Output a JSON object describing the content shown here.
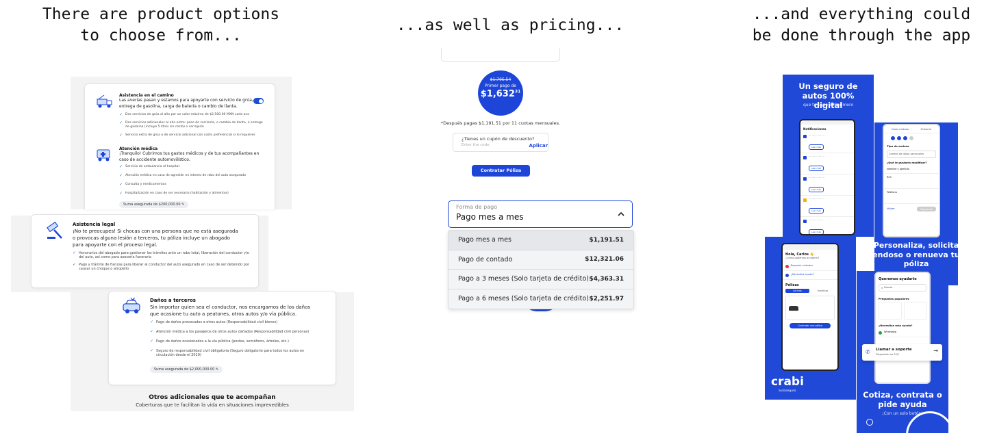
{
  "captions": {
    "left_line1": "There are product options",
    "left_line2": "to choose from...",
    "center": "...as well as pricing...",
    "right_line1": "...and everything could",
    "right_line2": "be done through the app"
  },
  "panel1": {
    "asistencia_camino": {
      "title": "Asistencia en el camino",
      "desc": "Las averías pasan y estamos para apoyarte con servicio de grúa, entrega de gasolina, carga de batería o cambio de llanta.",
      "bullets": [
        "Dos servicios de grúa al año por un valor máximo de $2,500.00 MXN cada uno",
        "Dos servicios adicionales al año entre: paso de corriente, o cambio de llanta, o entrega de gasolina (incluye 5 litros sin costo) o cerrajería",
        "Servicio extra de grúa o de servicio adicional con costo preferencial si lo requieres"
      ]
    },
    "atencion_medica": {
      "title": "Atención médica",
      "desc": "¡Tranquilo! Cubrimos tus gastos médicos y de tus acompañantes en caso de accidente automovilístico.",
      "bullets": [
        "Servicio de ambulancia al hospital",
        "Atención médica en caso de agresión en intento de robo del auto asegurado",
        "Consulta y medicamentos",
        "Hospitalización en caso de ser necesario (habitación y alimentos)"
      ],
      "sum_label": "Suma asegurada de $200,000.00"
    },
    "asistencia_legal": {
      "title": "Asistencia legal",
      "desc": "¡No te preocupes! Si chocas con una persona que no está asegurada o provocas alguna lesión a terceros, tu póliza incluye un abogado para apoyarte con el proceso legal.",
      "bullets": [
        "Honorarios del abogado para gestionar los trámites ante un robo total, liberación del conductor y/o del auto, así como para asesoría funeraria",
        "Pago y trámite de fianzas para liberar al conductor del auto asegurado en caso de ser detenido por causar un choque o atropello"
      ]
    },
    "danos_terceros": {
      "title": "Daños a terceros",
      "desc": "Sin importar quien sea el conductor, nos encargamos de los daños que ocasione tu auto a peatones, otros autos y/o vía pública.",
      "bullets": [
        "Pago de daños provocados a otros autos (Responsabilidad civil bienes)",
        "Atención médica a los pasajeros de otros autos dañados (Responsabilidad civil personas)",
        "Pago de daños ocasionados a la vía pública (postes, semáforos, árboles, etc.)",
        "Seguro de responsabilidad civil obligatoria (Seguro obligatorio para todos los autos en circulación desde el 2019)"
      ],
      "sum_label": "Suma asegurada de $2,000,000.00"
    },
    "otros": {
      "title": "Otros adicionales que te acompañan",
      "subtitle": "Coberturas que te facilitan la vida en situaciones imprevedibles"
    }
  },
  "panel2": {
    "old_price": "$1,795.54",
    "first_payment_label": "Primer pago de",
    "price_main": "$1,632",
    "price_cents": "31",
    "after_payments": "*Después pagas $1,191.51 por 11 cuotas mensuales.",
    "coupon_label": "¿Tienes un cupón de descuento?",
    "coupon_placeholder": "Enter the code",
    "apply_label": "Aplicar",
    "contract_label": "Contratar Póliza",
    "payment_form_label": "Forma de pago",
    "payment_selected": "Pago mes a mes",
    "payment_options": [
      {
        "label": "Pago mes a mes",
        "amount": "$1,191.51"
      },
      {
        "label": "Pago de contado",
        "amount": "$12,321.06"
      },
      {
        "label": "Pago a 3 meses (Solo tarjeta de crédito)",
        "amount": "$4,363.31"
      },
      {
        "label": "Pago a 6 meses (Solo tarjeta de crédito)",
        "amount": "$2,251.97"
      }
    ]
  },
  "panel3": {
    "headline1": "Un seguro de autos 100% digital",
    "sub1": "que te pone a ti primero",
    "headline2": "Personaliza, solicita endoso o renueva tu póliza",
    "headline3": "Cotiza, contrata o pide ayuda",
    "sub3": "¡Con un solo botón!",
    "brand": "crabi",
    "brand_sub": "autoseguro",
    "phone1": {
      "title": "Notificaciones",
      "btn": "Leer más"
    },
    "phone2": {
      "tab1": "Crear endoso",
      "tab2": "Historial",
      "field1": "Tipo de endoso",
      "field1_value": "Cambio de datos personales",
      "field2": "¿Qué le gustaría modificar?",
      "row1": "Nombre y apellido",
      "row2": "RFC",
      "row3": "Teléfono",
      "cancel": "Volver",
      "next": "Siguiente"
    },
    "phone3": {
      "greeting": "Hola, Carlos 👋",
      "greeting_sub": "¿Cómo podemos ayudarte?",
      "item1": "Reportar siniestro",
      "item2": "¿Necesitas ayuda?",
      "policies": "Pólizas",
      "tab_active": "Activas",
      "tab_inactive": "Inactivas",
      "cta": "Contratar una póliza"
    },
    "phone4": {
      "title": "Queremos ayudarte",
      "search_placeholder": "Buscar",
      "popular": "Preguntas populares",
      "help": "¿Necesitas más ayuda?",
      "whatsapp": "Whatsapp",
      "call": "Llamar a soporte",
      "call_sub": "Disponible las 24/7"
    }
  }
}
